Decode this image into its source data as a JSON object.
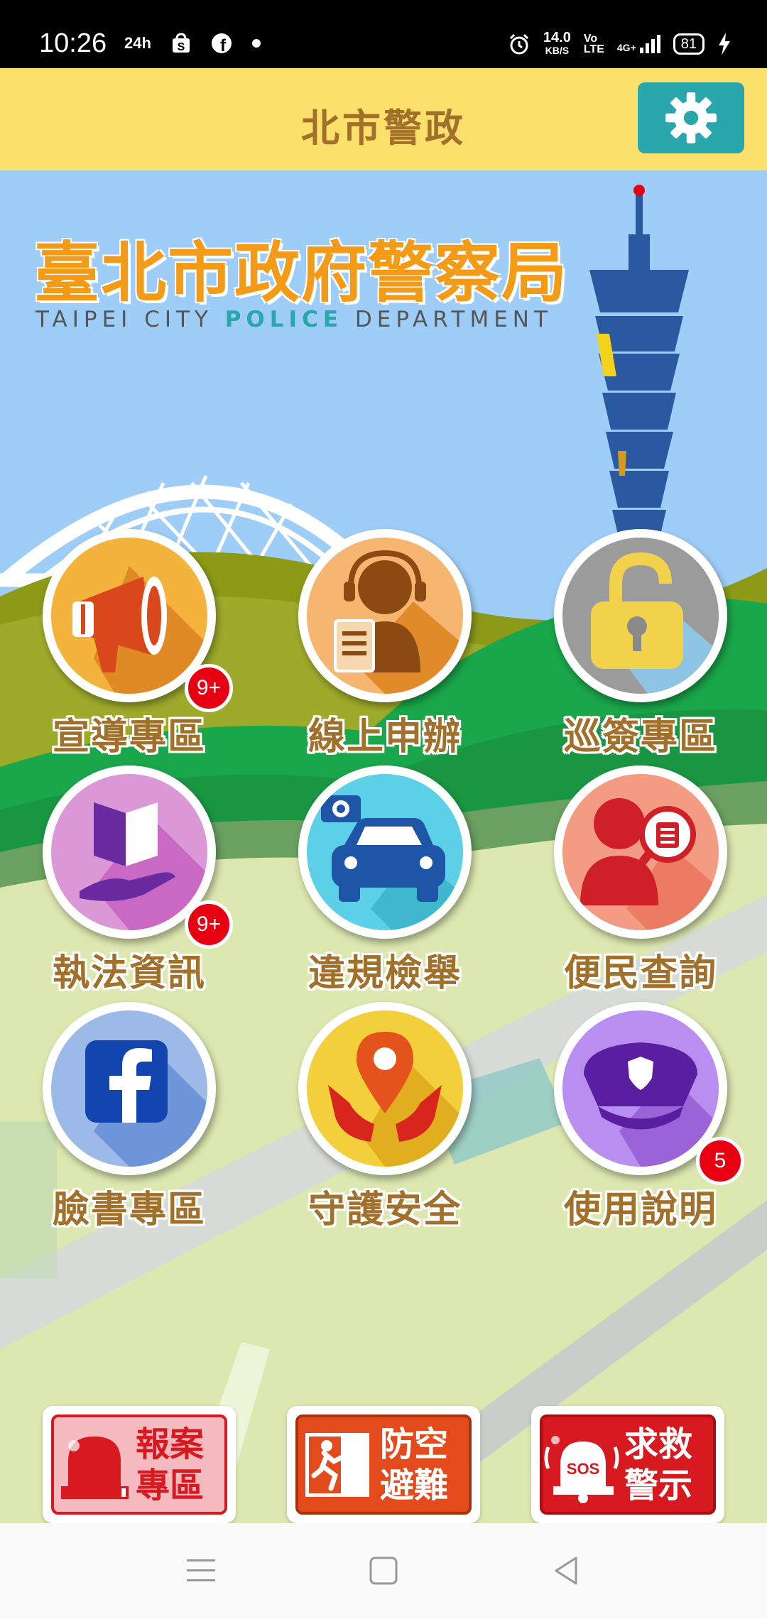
{
  "status_bar": {
    "time": "10:26",
    "icons_left": [
      "24h-icon",
      "shopee-icon",
      "facebook-icon",
      "dot-icon"
    ],
    "net_speed_value": "14.0",
    "net_speed_unit": "KB/S",
    "volte_top": "Vo",
    "volte_bottom": "LTE",
    "signal_label": "4G+",
    "battery": "81"
  },
  "header": {
    "title": "北市警政",
    "settings_icon": "gear-icon",
    "accent": "#fbe06b",
    "button_color": "#2aa6ad"
  },
  "banner": {
    "title_zh": "臺北市政府警察局",
    "title_en_1": "TAIPEI",
    "title_en_2": "CITY",
    "title_en_3": "POLICE",
    "title_en_4": "DEPARTMENT"
  },
  "menu": [
    {
      "label": "宣導專區",
      "icon": "megaphone-icon",
      "badge": "9+"
    },
    {
      "label": "線上申辦",
      "icon": "customer-service-icon",
      "badge": ""
    },
    {
      "label": "巡簽專區",
      "icon": "unlocked-padlock-icon",
      "badge": ""
    },
    {
      "label": "執法資訊",
      "icon": "book-in-hand-icon",
      "badge": "9+"
    },
    {
      "label": "違規檢舉",
      "icon": "car-camera-icon",
      "badge": ""
    },
    {
      "label": "便民查詢",
      "icon": "person-search-icon",
      "badge": ""
    },
    {
      "label": "臉書專區",
      "icon": "facebook-icon",
      "badge": ""
    },
    {
      "label": "守護安全",
      "icon": "location-hands-icon",
      "badge": ""
    },
    {
      "label": "使用說明",
      "icon": "police-cap-icon",
      "badge": "5"
    }
  ],
  "emergency": [
    {
      "line1": "報案",
      "line2": "專區",
      "icon": "siren-icon",
      "color": "#d71920"
    },
    {
      "line1": "防空",
      "line2": "避難",
      "icon": "running-exit-icon",
      "color": "#e34a1c"
    },
    {
      "line1": "求救",
      "line2": "警示",
      "icon": "sos-bell-icon",
      "color": "#d71920"
    }
  ],
  "nav": [
    "menu-icon",
    "home-icon",
    "back-icon"
  ]
}
